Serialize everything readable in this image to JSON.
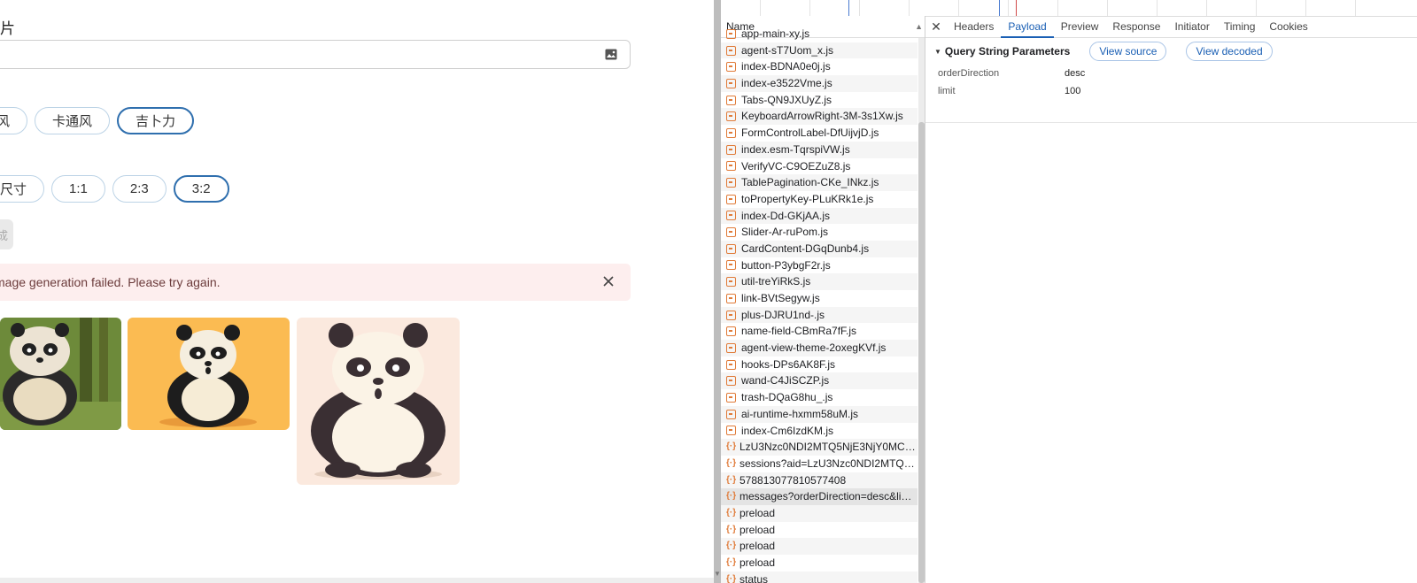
{
  "app": {
    "heading": "片",
    "alert_message": "mage generation failed. Please try again.",
    "generate_button_label": "成",
    "style_chips": [
      {
        "label": "风",
        "selected": false
      },
      {
        "label": "卡通风",
        "selected": false
      },
      {
        "label": "吉卜力",
        "selected": true
      }
    ],
    "ratio_chips": [
      {
        "label": "尺寸",
        "selected": false
      },
      {
        "label": "1:1",
        "selected": false
      },
      {
        "label": "2:3",
        "selected": false
      },
      {
        "label": "3:2",
        "selected": true
      }
    ]
  },
  "devtools": {
    "list_header": "Name",
    "requests": [
      {
        "name": "app-main-xy.js",
        "type": "script"
      },
      {
        "name": "agent-sT7Uom_x.js",
        "type": "script"
      },
      {
        "name": "index-BDNA0e0j.js",
        "type": "script"
      },
      {
        "name": "index-e3522Vme.js",
        "type": "script"
      },
      {
        "name": "Tabs-QN9JXUyZ.js",
        "type": "script"
      },
      {
        "name": "KeyboardArrowRight-3M-3s1Xw.js",
        "type": "script"
      },
      {
        "name": "FormControlLabel-DfUijvjD.js",
        "type": "script"
      },
      {
        "name": "index.esm-TqrspiVW.js",
        "type": "script"
      },
      {
        "name": "VerifyVC-C9OEZuZ8.js",
        "type": "script"
      },
      {
        "name": "TablePagination-CKe_INkz.js",
        "type": "script"
      },
      {
        "name": "toPropertyKey-PLuKRk1e.js",
        "type": "script"
      },
      {
        "name": "index-Dd-GKjAA.js",
        "type": "script"
      },
      {
        "name": "Slider-Ar-ruPom.js",
        "type": "script"
      },
      {
        "name": "CardContent-DGqDunb4.js",
        "type": "script"
      },
      {
        "name": "button-P3ybgF2r.js",
        "type": "script"
      },
      {
        "name": "util-treYiRkS.js",
        "type": "script"
      },
      {
        "name": "link-BVtSegyw.js",
        "type": "script"
      },
      {
        "name": "plus-DJRU1nd-.js",
        "type": "script"
      },
      {
        "name": "name-field-CBmRa7fF.js",
        "type": "script"
      },
      {
        "name": "agent-view-theme-2oxegKVf.js",
        "type": "script"
      },
      {
        "name": "hooks-DPs6AK8F.js",
        "type": "script"
      },
      {
        "name": "wand-C4JiSCZP.js",
        "type": "script"
      },
      {
        "name": "trash-DQaG8hu_.js",
        "type": "script"
      },
      {
        "name": "ai-runtime-hxmm58uM.js",
        "type": "script"
      },
      {
        "name": "index-Cm6IzdKM.js",
        "type": "script"
      },
      {
        "name": "LzU3Nzc0NDI2MTQ5NjE3NjY0MC9tY...",
        "type": "xhr"
      },
      {
        "name": "sessions?aid=LzU3Nzc0NDI2MTQ5Nj...",
        "type": "xhr"
      },
      {
        "name": "578813077810577408",
        "type": "xhr"
      },
      {
        "name": "messages?orderDirection=desc&limit...",
        "type": "xhr",
        "selected": true
      },
      {
        "name": "preload",
        "type": "xhr"
      },
      {
        "name": "preload",
        "type": "xhr"
      },
      {
        "name": "preload",
        "type": "xhr"
      },
      {
        "name": "preload",
        "type": "xhr"
      },
      {
        "name": "status",
        "type": "xhr"
      }
    ],
    "tabs": [
      "Headers",
      "Payload",
      "Preview",
      "Response",
      "Initiator",
      "Timing",
      "Cookies"
    ],
    "active_tab": "Payload",
    "section_title": "Query String Parameters",
    "view_source_label": "View source",
    "view_decoded_label": "View decoded",
    "params": [
      {
        "key": "orderDirection",
        "value": "desc"
      },
      {
        "key": "limit",
        "value": "100"
      }
    ],
    "colors": {
      "accent": "#1a5fb4",
      "script_icon": "#e07b39",
      "timeline_blue": "#4a7bd0",
      "timeline_red": "#d04a4a"
    }
  }
}
